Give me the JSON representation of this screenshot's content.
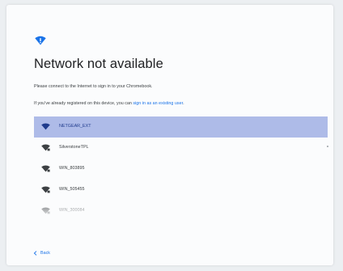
{
  "page": {
    "title": "Network not available",
    "line1": "Please connect to the Internet to sign in to your Chromebook.",
    "line2_prefix": "If you've already registered on this device, you can ",
    "line2_link": "sign in as an existing user",
    "line2_suffix": "."
  },
  "networks": [
    {
      "name": "NETGEAR_EXT",
      "selected": true,
      "secured": false
    },
    {
      "name": "SilverstoneTPL",
      "selected": false,
      "secured": true
    },
    {
      "name": "WIN_803895",
      "selected": false,
      "secured": true
    },
    {
      "name": "WIN_505455",
      "selected": false,
      "secured": true
    },
    {
      "name": "WIN_300084",
      "selected": false,
      "secured": true
    }
  ],
  "footer": {
    "back_label": "Back"
  },
  "icons": {
    "header": "network-warning-icon",
    "wifi": "wifi-icon",
    "back": "chevron-left-icon"
  },
  "colors": {
    "accent": "#1a73e8",
    "selected_row": "#aebbe8",
    "icon_dark": "#3c4043"
  }
}
